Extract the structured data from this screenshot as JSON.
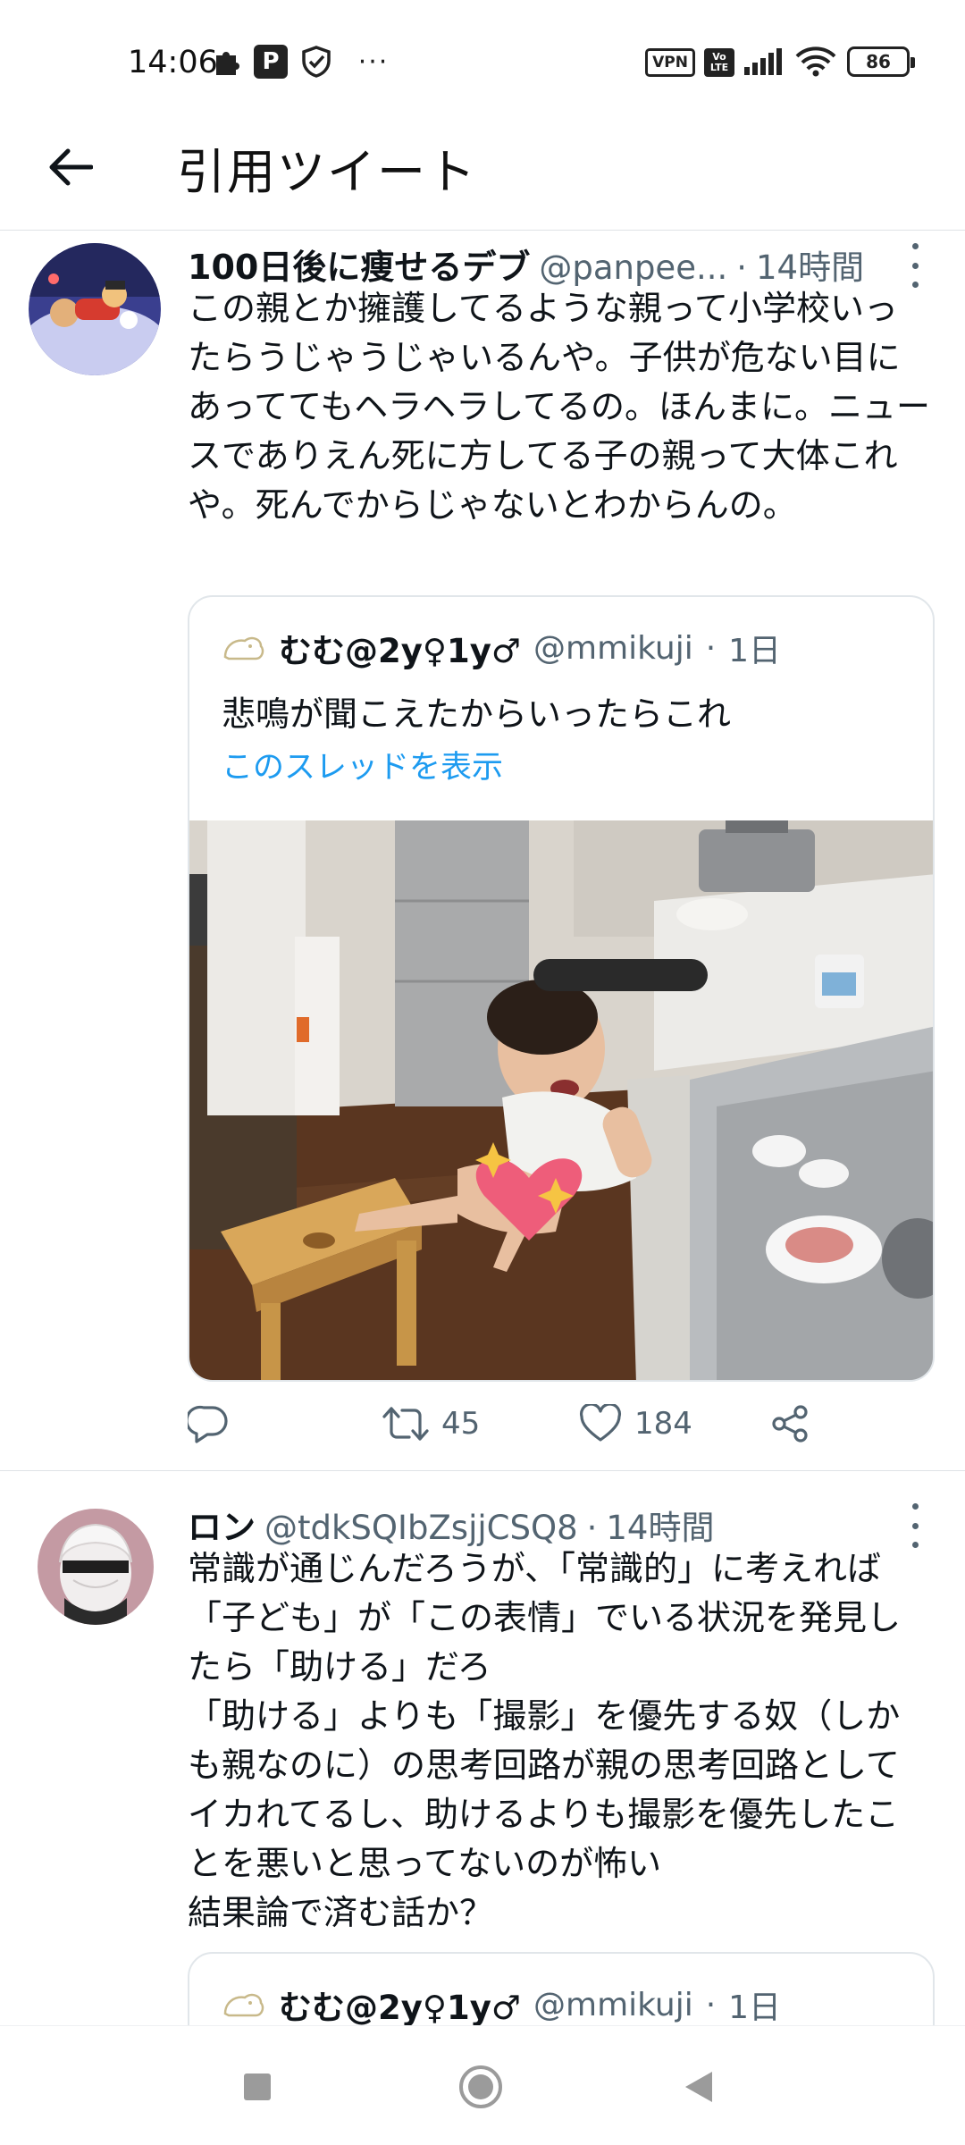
{
  "status_bar": {
    "time": "14:06",
    "p_icon_letter": "P",
    "more_dots": "···",
    "vpn_label": "VPN",
    "volte_label_1": "Vo",
    "volte_label_2": "LTE",
    "battery": "86"
  },
  "header": {
    "title": "引用ツイート"
  },
  "tweets": [
    {
      "display_name": "100日後に痩せるデブ",
      "handle": "@panpee...",
      "separator": "·",
      "time": "14時間",
      "text": "この親とか擁護してるような親って小学校いったらうじゃうじゃいるんや。子供が危ない目にあっててもヘラヘラしてるの。ほんまに。ニュースでありえん死に方してる子の親って大体これや。死んでからじゃないとわからんの。",
      "quote": {
        "display_name": "むむ@2y♀1y♂",
        "handle": "@mmikuji",
        "separator": "·",
        "time": "1日",
        "text": "悲鳴が聞こえたからいったらこれ",
        "thread_link": "このスレッドを表示"
      },
      "actions": {
        "retweets": "45",
        "likes": "184"
      }
    },
    {
      "display_name": "ロン",
      "handle": "@tdkSQIbZsjjCSQ8",
      "separator": "·",
      "time": "14時間",
      "text": "常識が通じんだろうが、「常識的」に考えれば「子ども」が「この表情」でいる状況を発見したら「助ける」だろ\n「助ける」よりも「撮影」を優先する奴（しかも親なのに）の思考回路が親の思考回路としてイカれてるし、助けるよりも撮影を優先したことを悪いと思ってないのが怖い\n結果論で済む話か？",
      "quote": {
        "display_name": "むむ@2y♀1y♂",
        "handle": "@mmikuji",
        "separator": "·",
        "time": "1日"
      }
    }
  ],
  "colors": {
    "link": "#1d9bf0",
    "secondary_text": "#536471",
    "primary_text": "#0f1419",
    "divider": "#dfe3e6"
  }
}
